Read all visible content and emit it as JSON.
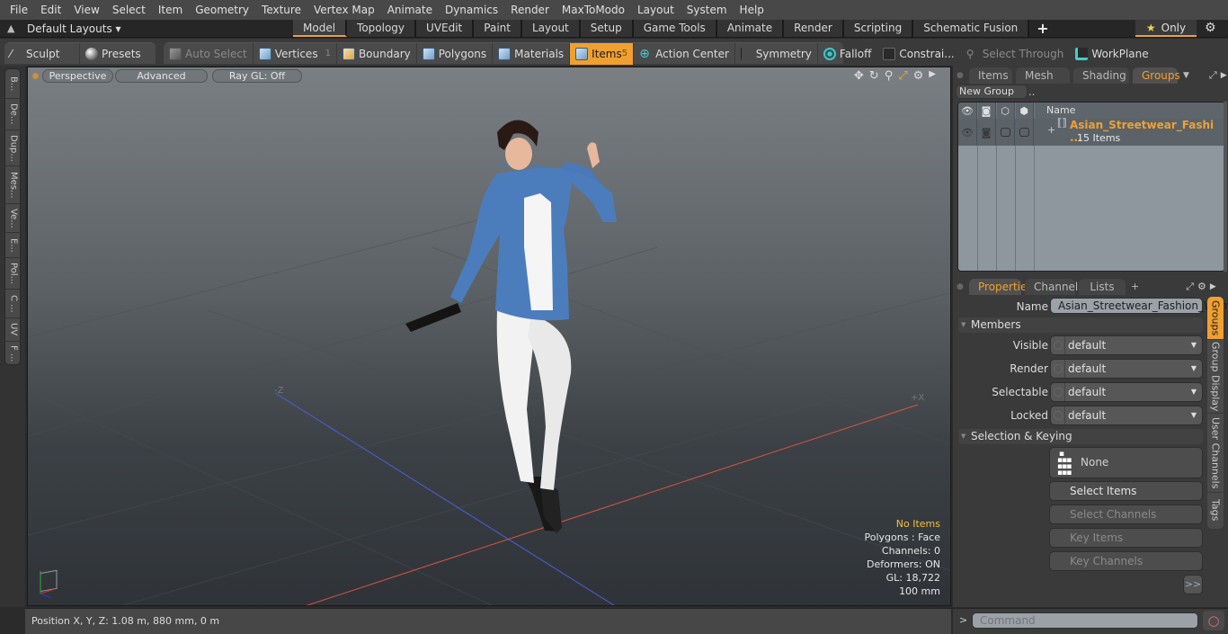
{
  "menu": [
    "File",
    "Edit",
    "View",
    "Select",
    "Item",
    "Geometry",
    "Texture",
    "Vertex Map",
    "Animate",
    "Dynamics",
    "Render",
    "MaxToModo",
    "Layout",
    "System",
    "Help"
  ],
  "layouts": {
    "dropdown_label": "Default Layouts ▾",
    "tabs": [
      "Model",
      "Topology",
      "UVEdit",
      "Paint",
      "Layout",
      "Setup",
      "Game Tools",
      "Animate",
      "Render",
      "Scripting",
      "Schematic Fusion"
    ],
    "active_tab": "Model",
    "add_tab": "+",
    "only_label": "Only"
  },
  "toolbar": {
    "sculpt": "Sculpt",
    "presets": "Presets",
    "auto_select": "Auto Select",
    "vertices": "Vertices",
    "vertices_count": "1",
    "boundary": "Boundary",
    "polygons": "Polygons",
    "materials": "Materials",
    "items": "Items",
    "items_count": "5",
    "action_center": "Action Center",
    "symmetry": "Symmetry",
    "falloff": "Falloff",
    "constraints": "Constrai...",
    "select_through": "Select Through",
    "workplane": "WorkPlane"
  },
  "left_tabs": [
    "B...",
    "De...",
    "Dup...",
    "Mes...",
    "Ve...",
    "E...",
    "Pol...",
    "C ...",
    "UV",
    "F ..."
  ],
  "viewport": {
    "view_mode": "Perspective",
    "shading": "Advanced",
    "raygl": "Ray GL: Off",
    "axis_neg_z": "-Z",
    "axis_pos_x": "+X",
    "stats": {
      "selection": "No Items",
      "polygons": "Polygons : Face",
      "channels": "Channels: 0",
      "deformers": "Deformers: ON",
      "gl": "GL: 18,722",
      "scale": "100 mm"
    }
  },
  "status": {
    "position": "Position X, Y, Z:   1.08 m, 880 mm, 0 m"
  },
  "groups_panel": {
    "tabs": [
      "Items",
      "Mesh ...",
      "Shading",
      "Groups"
    ],
    "active_tab": "Groups",
    "new_group": "New Group",
    "column_name": "Name",
    "group": {
      "name": "Asian_Streetwear_Fashi ...",
      "count": "15 Items"
    }
  },
  "properties_panel": {
    "tabs": [
      "Properties",
      "Channels",
      "Lists"
    ],
    "active_tab": "Properties",
    "add_tab": "+",
    "name_label": "Name",
    "name_value": "Asian_Streetwear_Fashion_Wom",
    "members_section": "Members",
    "members": [
      {
        "label": "Visible",
        "value": "default"
      },
      {
        "label": "Render",
        "value": "default"
      },
      {
        "label": "Selectable",
        "value": "default"
      },
      {
        "label": "Locked",
        "value": "default"
      }
    ],
    "selection_section": "Selection & Keying",
    "none_button": "None",
    "buttons": [
      {
        "label": "Select Items",
        "enabled": true
      },
      {
        "label": "Select Channels",
        "enabled": false
      },
      {
        "label": "Key Items",
        "enabled": false
      },
      {
        "label": "Key Channels",
        "enabled": false
      }
    ],
    "more_button": ">>",
    "side_tabs": [
      "Groups",
      "Group Display",
      "User Channels",
      "Tags"
    ]
  },
  "command": {
    "prompt": ">",
    "placeholder": "Command"
  },
  "colors": {
    "accent": "#f0a030",
    "group_name": "#f0a030"
  }
}
